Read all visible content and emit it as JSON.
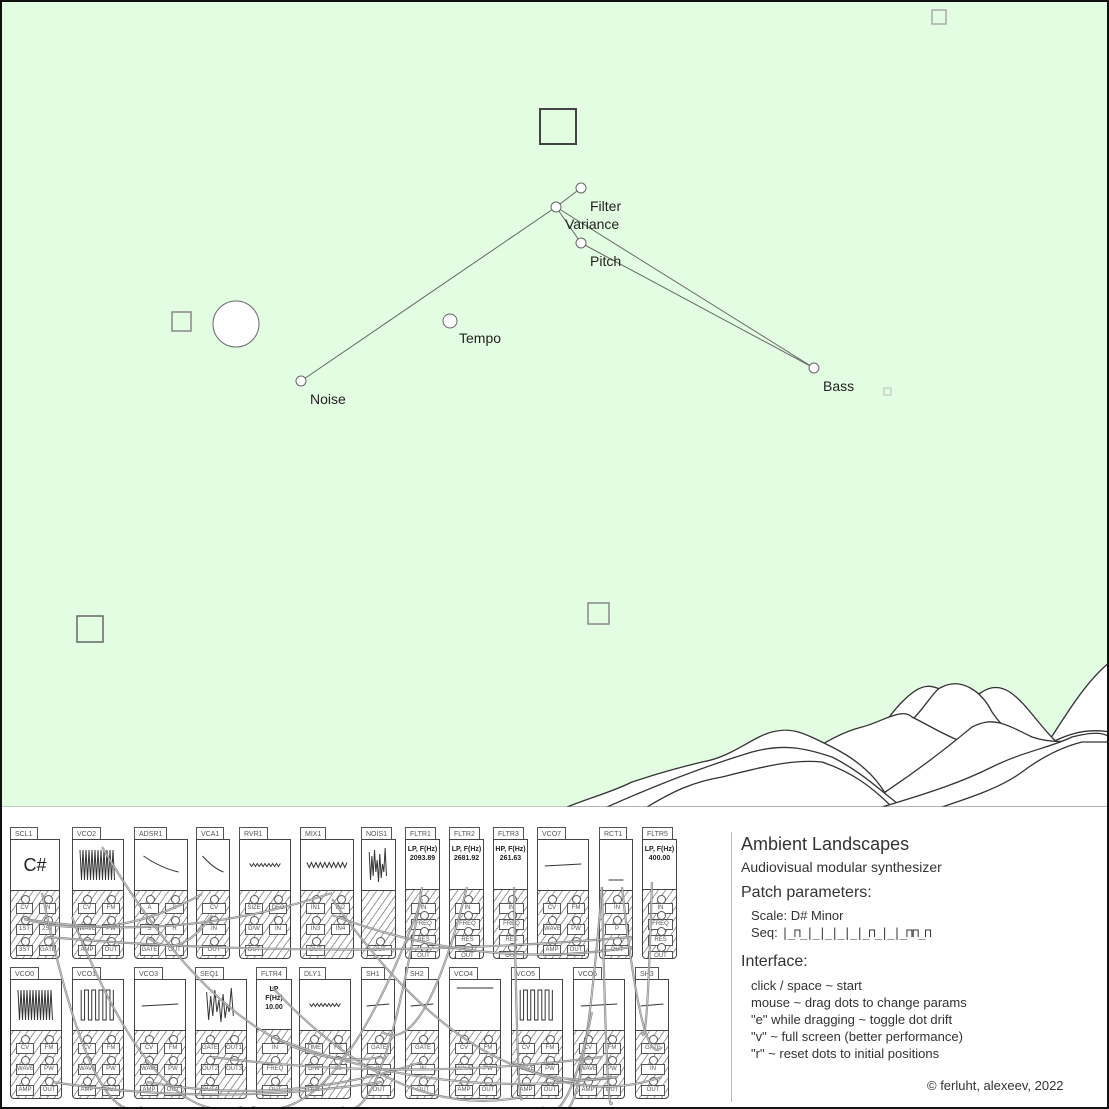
{
  "app": {
    "title": "Ambient Landscapes",
    "subtitle": "Audiovisual modular synthesizer",
    "colors": {
      "sky": "#e3fde3",
      "ink": "#222222",
      "panel": "#ffffff"
    }
  },
  "scene": {
    "dots": [
      {
        "id": "filter",
        "label": "Filter"
      },
      {
        "id": "variance",
        "label": "Variance"
      },
      {
        "id": "pitch",
        "label": "Pitch"
      },
      {
        "id": "tempo",
        "label": "Tempo"
      },
      {
        "id": "noise",
        "label": "Noise"
      },
      {
        "id": "bass",
        "label": "Bass"
      }
    ]
  },
  "modules_row1": [
    {
      "name": "SCL1",
      "display": {
        "type": "note",
        "text": "C#"
      },
      "ports": [
        "CV",
        "IN",
        "1ST",
        "2ST",
        "3ST",
        "GATE"
      ]
    },
    {
      "name": "VCO2",
      "display": {
        "type": "wave",
        "wave": "dense"
      },
      "ports": [
        "CV",
        "FM",
        "WAVE",
        "PW",
        "AMP",
        "OUT"
      ]
    },
    {
      "name": "ADSR1",
      "display": {
        "type": "wave",
        "wave": "decay"
      },
      "ports": [
        "A",
        "D",
        "S",
        "R",
        "GATE",
        "OUT"
      ]
    },
    {
      "name": "VCA1",
      "display": {
        "type": "wave",
        "wave": "decay"
      },
      "ports": [
        "CV",
        "IN",
        "OUT"
      ]
    },
    {
      "name": "RVR1",
      "display": {
        "type": "wave",
        "wave": "ripple"
      },
      "ports": [
        "SIZE",
        "DEC",
        "D/W",
        "IN",
        "OUT"
      ]
    },
    {
      "name": "MIX1",
      "display": {
        "type": "wave",
        "wave": "zigzag"
      },
      "ports": [
        "IN1",
        "IN2",
        "IN3",
        "IN4",
        "OUT"
      ]
    },
    {
      "name": "NOIS1",
      "display": {
        "type": "wave",
        "wave": "noise"
      },
      "ports": [
        "OUT"
      ]
    },
    {
      "name": "FLTR1",
      "display": {
        "type": "text",
        "lines": [
          "LP, F(Hz)",
          "2093.89"
        ]
      },
      "ports": [
        "IN",
        "FREQ",
        "RES",
        "OUT"
      ]
    },
    {
      "name": "FLTR2",
      "display": {
        "type": "text",
        "lines": [
          "LP, F(Hz)",
          "2681.92"
        ]
      },
      "ports": [
        "IN",
        "FREQ",
        "RES",
        "OUT"
      ]
    },
    {
      "name": "FLTR3",
      "display": {
        "type": "text",
        "lines": [
          "HP, F(Hz)",
          "261.63"
        ]
      },
      "ports": [
        "IN",
        "FREQ",
        "RES",
        "OUT"
      ]
    },
    {
      "name": "VCO7",
      "display": {
        "type": "wave",
        "wave": "flat"
      },
      "ports": [
        "CV",
        "FM",
        "WAVE",
        "PW",
        "AMP",
        "OUT"
      ]
    },
    {
      "name": "RCT1",
      "display": {
        "type": "wave",
        "wave": "low"
      },
      "ports": [
        "IN",
        "P",
        "OUT"
      ]
    },
    {
      "name": "FLTR5",
      "display": {
        "type": "text",
        "lines": [
          "LP, F(Hz)",
          "400.00"
        ]
      },
      "ports": [
        "IN",
        "FREQ",
        "RES",
        "OUT"
      ]
    }
  ],
  "modules_row2": [
    {
      "name": "VCO0",
      "display": {
        "type": "wave",
        "wave": "dense"
      },
      "ports": [
        "CV",
        "FM",
        "WAVE",
        "PW",
        "AMP",
        "OUT"
      ]
    },
    {
      "name": "VCO1",
      "display": {
        "type": "wave",
        "wave": "square"
      },
      "ports": [
        "CV",
        "FM",
        "WAVE",
        "PW",
        "AMP",
        "OUT"
      ]
    },
    {
      "name": "VCO3",
      "display": {
        "type": "wave",
        "wave": "flat"
      },
      "ports": [
        "CV",
        "FM",
        "WAVE",
        "PW",
        "AMP",
        "OUT"
      ]
    },
    {
      "name": "SEQ1",
      "display": {
        "type": "wave",
        "wave": "noise"
      },
      "ports": [
        "GATE",
        "OUT1",
        "OUT2",
        "OUT3",
        "OUT4"
      ]
    },
    {
      "name": "FLTR4",
      "display": {
        "type": "text",
        "lines": [
          "LP",
          "F(Hz)",
          "10.00"
        ]
      },
      "ports": [
        "IN",
        "FREQ",
        "OUT"
      ]
    },
    {
      "name": "DLY1",
      "display": {
        "type": "wave",
        "wave": "ripple"
      },
      "ports": [
        "TIME",
        "FB",
        "D/W",
        "IN",
        "OUT"
      ]
    },
    {
      "name": "SH1",
      "display": {
        "type": "wave",
        "wave": "flat"
      },
      "ports": [
        "GATE",
        "IN",
        "OUT"
      ]
    },
    {
      "name": "SH2",
      "display": {
        "type": "wave",
        "wave": "flat"
      },
      "ports": [
        "GATE",
        "IN",
        "OUT"
      ]
    },
    {
      "name": "VCO4",
      "display": {
        "type": "wave",
        "wave": "high"
      },
      "ports": [
        "CV",
        "FM",
        "WAVE",
        "PW",
        "AMP",
        "OUT"
      ]
    },
    {
      "name": "VCO5",
      "display": {
        "type": "wave",
        "wave": "square"
      },
      "ports": [
        "CV",
        "FM",
        "WAVE",
        "PW",
        "AMP",
        "OUT"
      ]
    },
    {
      "name": "VCO6",
      "display": {
        "type": "wave",
        "wave": "flat"
      },
      "ports": [
        "CV",
        "FM",
        "WAVE",
        "PW",
        "AMP",
        "OUT"
      ]
    },
    {
      "name": "SH3",
      "display": {
        "type": "wave",
        "wave": "flat"
      },
      "ports": [
        "GATE",
        "IN",
        "OUT"
      ]
    }
  ],
  "info": {
    "patch_heading": "Patch parameters:",
    "scale_line": "Scale: D# Minor",
    "seq_label": "Seq:",
    "seq_pattern": "|_⊓_|_|_|_|_|_⊓_|_|_⊓⊓_⊓",
    "interface_heading": "Interface:",
    "controls": [
      "click / space ~ start",
      "mouse ~ drag dots to change params",
      "\"e\" while dragging ~ toggle dot drift",
      "\"v\" ~ full screen (better performance)",
      "\"r\" ~ reset dots to initial positions"
    ],
    "copyright": "© ferluht, alexeev, 2022"
  }
}
